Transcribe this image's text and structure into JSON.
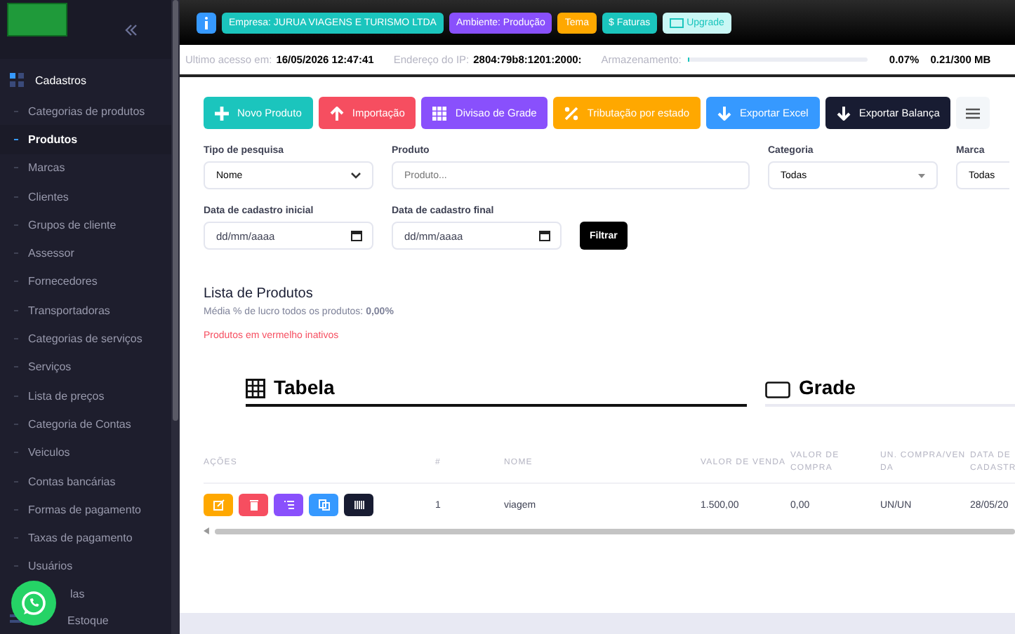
{
  "sidebar": {
    "section": "Cadastros",
    "items": [
      {
        "label": "Categorias de produtos",
        "selected": false
      },
      {
        "label": "Produtos",
        "selected": true
      },
      {
        "label": "Marcas",
        "selected": false
      },
      {
        "label": "Clientes",
        "selected": false
      },
      {
        "label": "Grupos de cliente",
        "selected": false
      },
      {
        "label": "Assessor",
        "selected": false
      },
      {
        "label": "Fornecedores",
        "selected": false
      },
      {
        "label": "Transportadoras",
        "selected": false
      },
      {
        "label": "Categorias de serviços",
        "selected": false
      },
      {
        "label": "Serviços",
        "selected": false
      },
      {
        "label": "Lista de preços",
        "selected": false
      },
      {
        "label": "Categoria de Contas",
        "selected": false
      },
      {
        "label": "Veiculos",
        "selected": false
      },
      {
        "label": "Contas bancárias",
        "selected": false
      },
      {
        "label": "Formas de pagamento",
        "selected": false
      },
      {
        "label": "Taxas de pagamento",
        "selected": false
      },
      {
        "label": "Usuários",
        "selected": false
      }
    ],
    "next_sections": [
      "las",
      "Estoque"
    ]
  },
  "header": {
    "badges": [
      {
        "kind": "info",
        "color": "#3699ff"
      },
      {
        "kind": "text",
        "label": "Empresa: JURUA VIAGENS E TURISMO LTDA",
        "color": "#1bc5bd"
      },
      {
        "kind": "text",
        "label": "Ambiente: Produção",
        "color": "#8950fc"
      },
      {
        "kind": "text",
        "label": "Tema",
        "color": "#ffa800"
      },
      {
        "kind": "text",
        "label": "$ Faturas",
        "color": "#1bc5bd"
      },
      {
        "kind": "upgrade",
        "label": "Upgrade",
        "color": "#c9f7f5"
      }
    ]
  },
  "info_bar": {
    "last_access_label": "Ultimo acesso em:",
    "last_access": "16/05/2026 12:47:41",
    "ip_label": "Endereço do IP:",
    "ip": "2804:79b8:1201:2000:",
    "storage_label": "Armazenamento:",
    "storage_bar": {
      "level": 0.0007
    },
    "storage_percent": "0.07%",
    "storage_used": "0.21/300 MB"
  },
  "toolbar": [
    {
      "label": "Novo Produto",
      "color": "#1bc5bd"
    },
    {
      "label": "Importação",
      "color": "#f64e60"
    },
    {
      "label": "Divisao de Grade",
      "color": "#8950fc"
    },
    {
      "label": "Tributação por estado",
      "color": "#ffa800"
    },
    {
      "label": "Exportar Excel",
      "color": "#3699ff"
    },
    {
      "label": "Exportar Balança",
      "color": "#181c32"
    }
  ],
  "filters": {
    "search_type": {
      "label": "Tipo de pesquisa",
      "value": "Nome"
    },
    "product": {
      "label": "Produto",
      "placeholder": "Produto..."
    },
    "category": {
      "label": "Categoria",
      "value": "Todas"
    },
    "brand": {
      "label": "Marca",
      "value": "Todas"
    },
    "date_start": {
      "label": "Data de cadastro inicial",
      "placeholder": "dd/mm/aaaa"
    },
    "date_end": {
      "label": "Data de cadastro final",
      "placeholder": "dd/mm/aaaa"
    },
    "button": "Filtrar"
  },
  "list": {
    "title": "Lista de Produtos",
    "profit_text": "Média % de lucro todos os produtos: **0,00%**",
    "inactive_note": "Produtos em vermelho inativos"
  },
  "view_tabs": [
    {
      "label": "Tabela",
      "selected": true
    },
    {
      "label": "Grade",
      "selected": false
    }
  ],
  "table": {
    "columns": [
      "AÇÕES",
      "#",
      "NOME",
      "VALOR DE VENDA",
      "VALOR DE COMPRA",
      "UN. COMPRA/VEN DA",
      "DATA DE CADASTR"
    ],
    "rows": [
      {
        "actions": [
          {
            "color": "#ffa800"
          },
          {
            "color": "#f64e60"
          },
          {
            "color": "#8950fc"
          },
          {
            "color": "#3699ff"
          },
          {
            "color": "#181c32"
          }
        ],
        "cells": [
          "",
          "1",
          "viagem",
          "1.500,00",
          "0,00",
          "UN/UN",
          "28/05/20"
        ]
      }
    ]
  }
}
